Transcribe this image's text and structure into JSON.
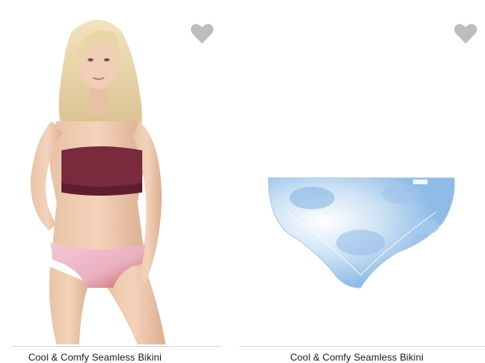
{
  "products": [
    {
      "title": "Cool & Comfy Seamless Bikini",
      "favorite_icon": "heart-icon"
    },
    {
      "title": "Cool & Comfy Seamless Bikini",
      "favorite_icon": "heart-icon"
    }
  ],
  "colors": {
    "heart": "#bdbdbd",
    "divider": "#d9d9d9",
    "text": "#1a1a1a"
  }
}
